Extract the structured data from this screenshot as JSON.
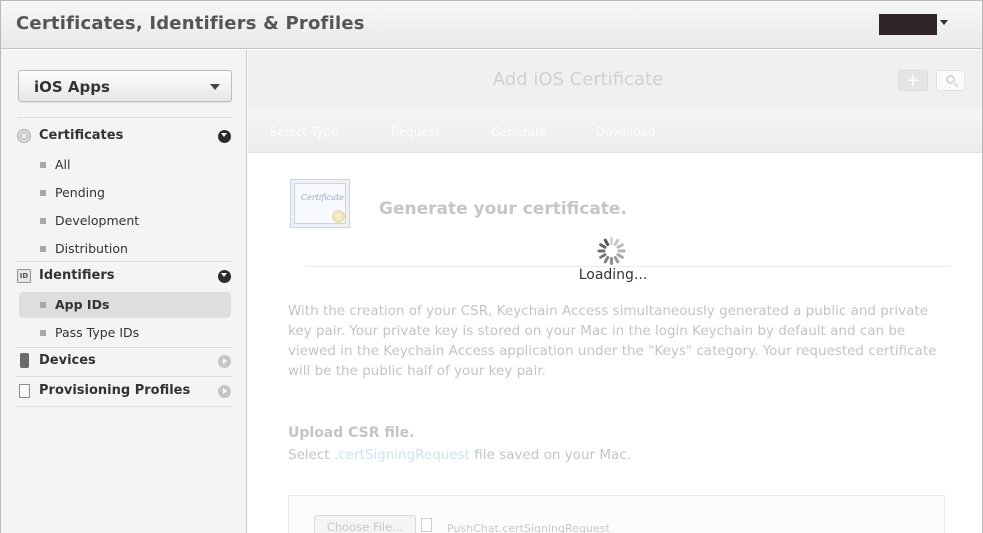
{
  "header": {
    "title": "Certificates, Identifiers & Profiles"
  },
  "sidebar": {
    "platform": "iOS Apps",
    "sections": [
      {
        "label": "Certificates",
        "icon": "certificate-icon",
        "state": "expanded",
        "items": [
          {
            "label": "All"
          },
          {
            "label": "Pending"
          },
          {
            "label": "Development"
          },
          {
            "label": "Distribution"
          }
        ]
      },
      {
        "label": "Identifiers",
        "icon": "id-icon",
        "state": "expanded",
        "items": [
          {
            "label": "App IDs",
            "active": true
          },
          {
            "label": "Pass Type IDs"
          }
        ]
      },
      {
        "label": "Devices",
        "icon": "device-icon",
        "state": "collapsed"
      },
      {
        "label": "Provisioning Profiles",
        "icon": "profile-icon",
        "state": "collapsed"
      }
    ]
  },
  "main": {
    "title": "Add iOS Certificate",
    "steps": [
      "Select Type",
      "Request",
      "Generate",
      "Download"
    ],
    "heading": "Generate your certificate.",
    "loading": "Loading...",
    "cert_image_text": "Certificate",
    "description": "With the creation of your CSR, Keychain Access simultaneously generated a public and private key pair. Your private key is stored on your Mac in the login Keychain by default and can be viewed in the Keychain Access application under the \"Keys\" category. Your requested certificate will be the public half of your key pair.",
    "upload_title": "Upload CSR file.",
    "upload_sub_prefix": "Select ",
    "upload_sub_ext": ".certSigningRequest",
    "upload_sub_suffix": " file saved on your Mac.",
    "choose_file_label": "Choose File...",
    "file_name": "PushChat.certSigningRequest"
  },
  "colors": {
    "header_bg": "#eeeeee",
    "sidebar_bg": "#f4f4f4",
    "active_item_bg": "#dedede",
    "faded_text": "#c4c4c4",
    "link_faded": "#cfe3ef"
  }
}
